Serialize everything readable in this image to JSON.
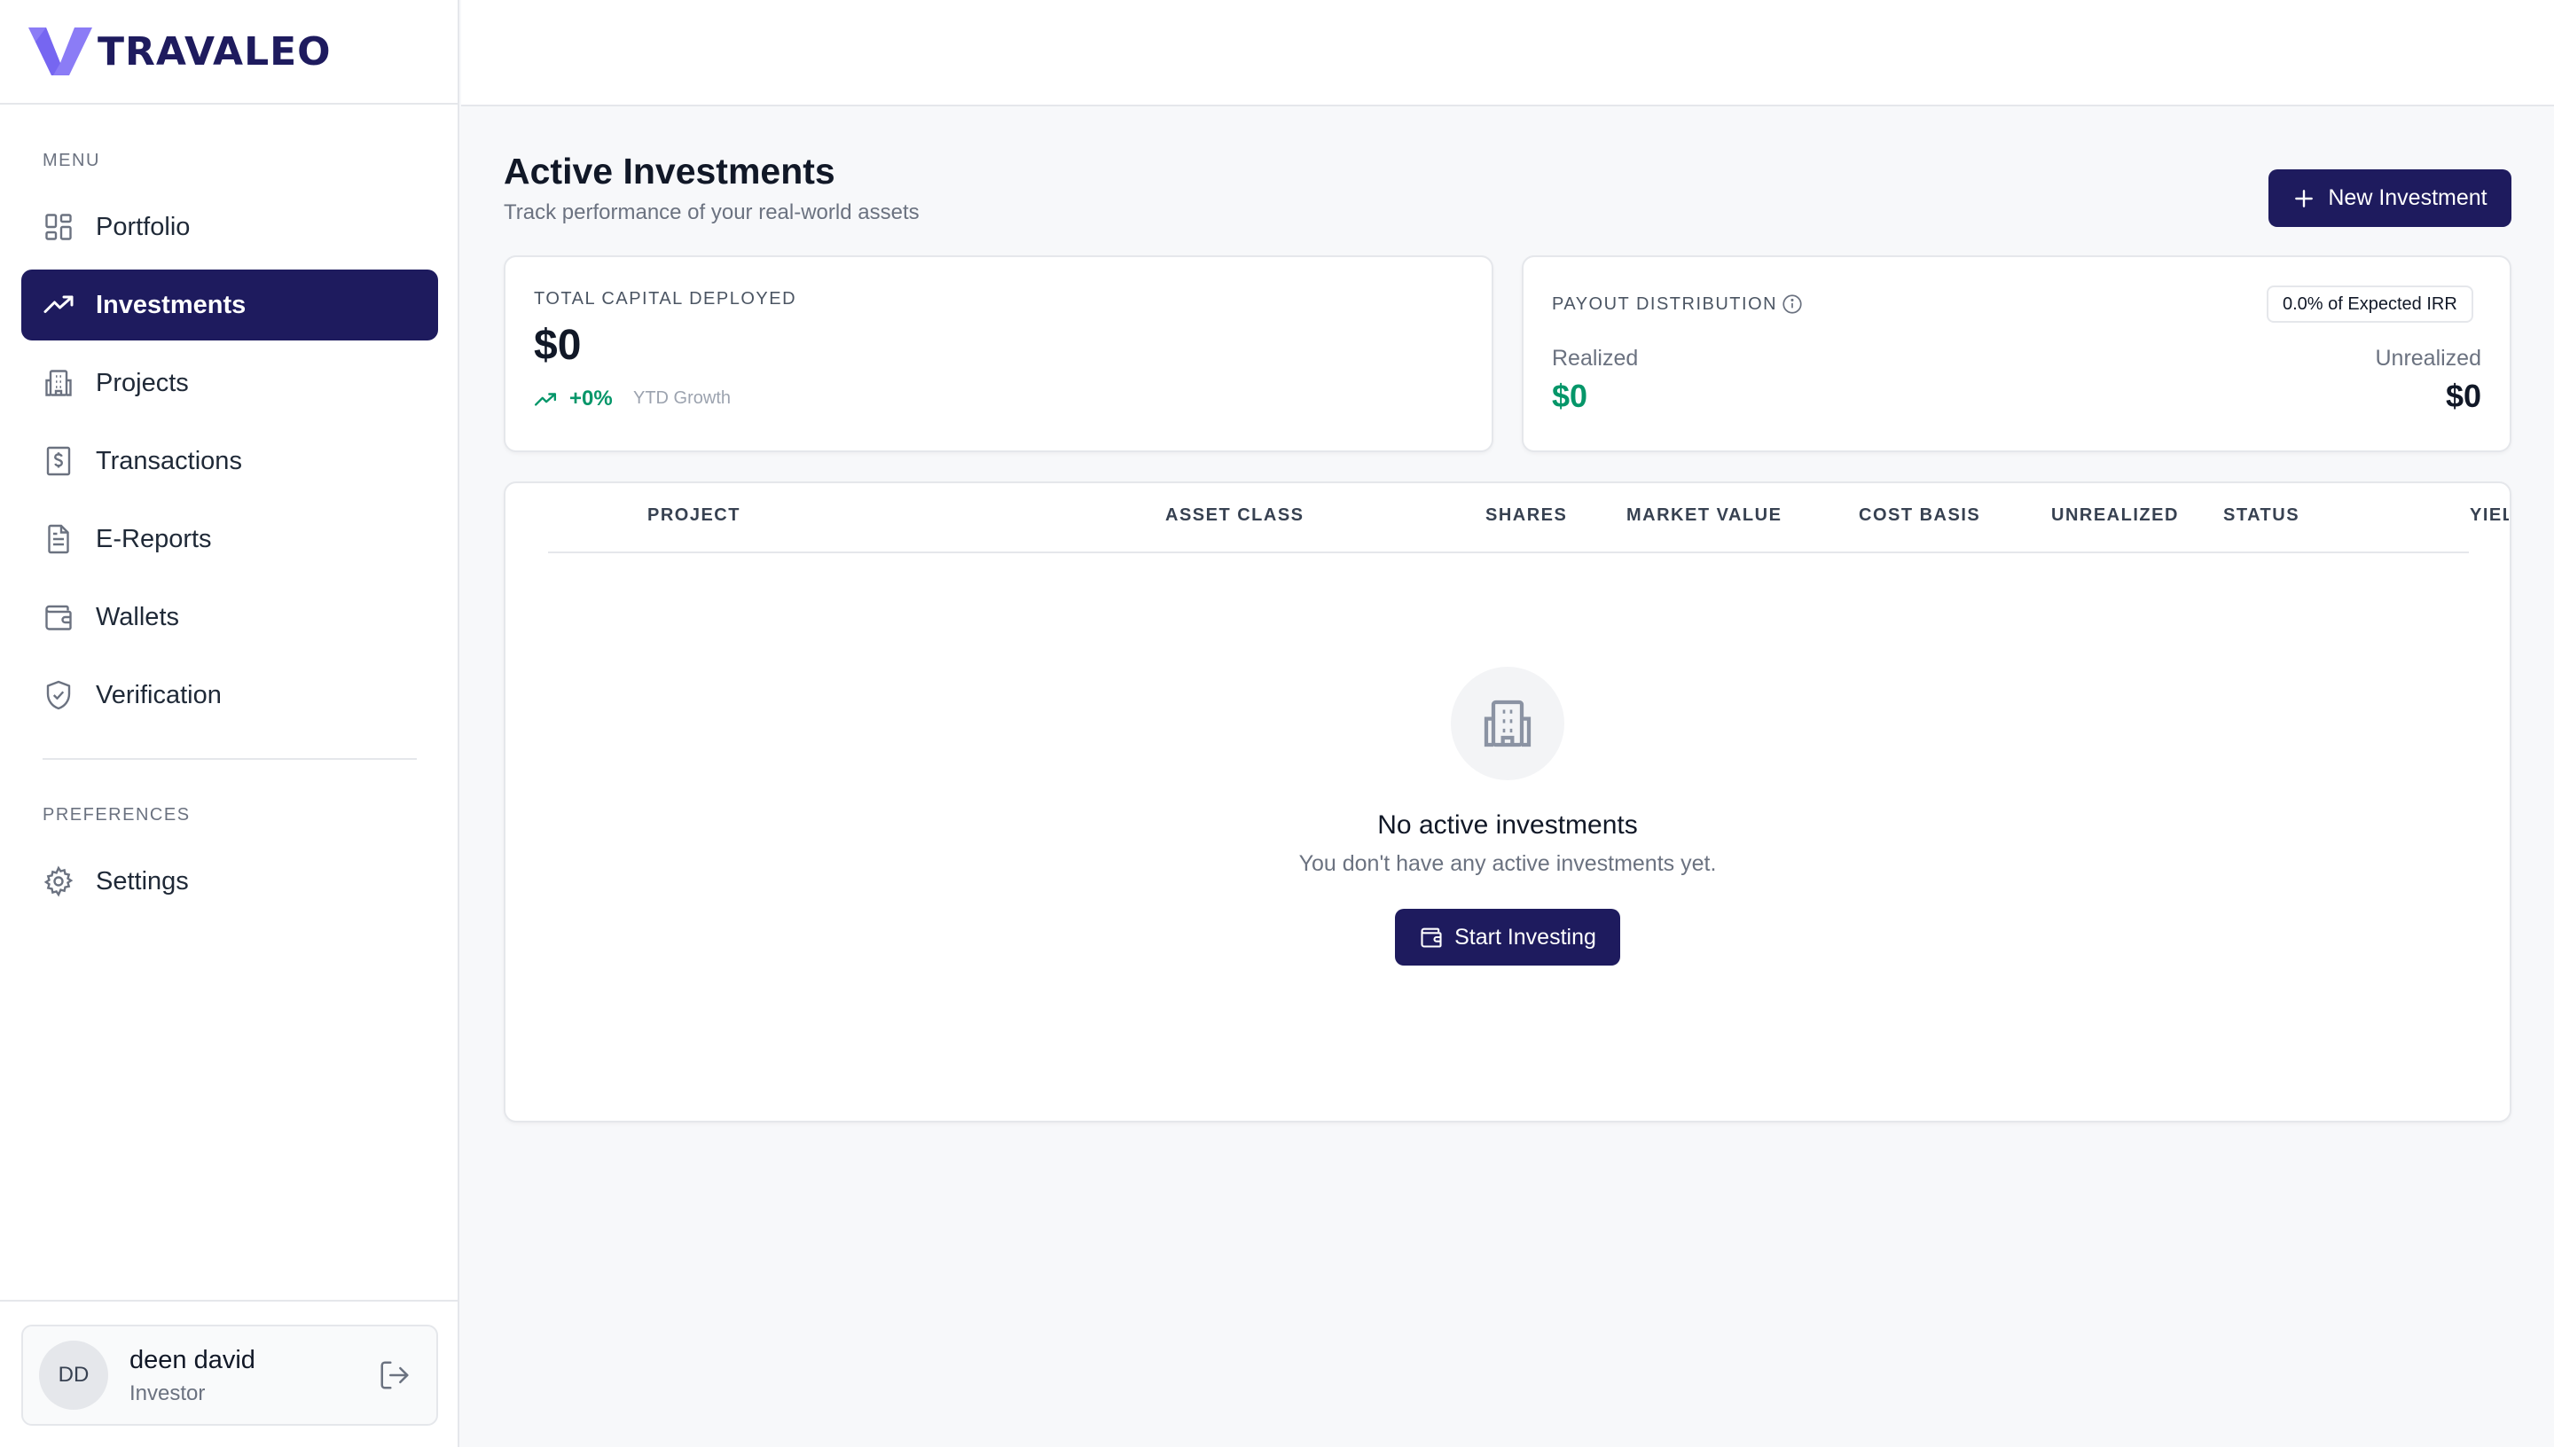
{
  "app": {
    "brand": "TRAVALEO"
  },
  "sidebar": {
    "menu_label": "MENU",
    "items": [
      {
        "label": "Portfolio",
        "icon": "grid-icon"
      },
      {
        "label": "Investments",
        "icon": "trending-up-icon",
        "active": true
      },
      {
        "label": "Projects",
        "icon": "building-icon"
      },
      {
        "label": "Transactions",
        "icon": "receipt-icon"
      },
      {
        "label": "E-Reports",
        "icon": "document-icon"
      },
      {
        "label": "Wallets",
        "icon": "wallet-icon"
      },
      {
        "label": "Verification",
        "icon": "shield-check-icon"
      }
    ],
    "preferences_label": "PREFERENCES",
    "settings_label": "Settings",
    "user": {
      "initials": "DD",
      "name": "deen david",
      "role": "Investor"
    }
  },
  "main": {
    "title": "Active Investments",
    "subtitle": "Track performance of your real-world assets",
    "new_button": "New Investment",
    "capital_card": {
      "label": "TOTAL CAPITAL DEPLOYED",
      "value": "$0",
      "growth": "+0%",
      "growth_label": "YTD Growth"
    },
    "payout_card": {
      "label": "PAYOUT DISTRIBUTION",
      "badge": "0.0% of Expected IRR",
      "realized_label": "Realized",
      "realized_value": "$0",
      "unrealized_label": "Unrealized",
      "unrealized_value": "$0"
    },
    "table": {
      "columns": [
        "PROJECT",
        "ASSET CLASS",
        "SHARES",
        "MARKET VALUE",
        "COST BASIS",
        "UNREALIZED",
        "STATUS",
        "YIEL"
      ]
    },
    "empty_state": {
      "title": "No active investments",
      "subtitle": "You don't have any active investments yet.",
      "button": "Start Investing"
    }
  },
  "colors": {
    "brand": "#1e1b5e",
    "accent_green": "#059669",
    "logo_purple": "#8b7cf6"
  }
}
